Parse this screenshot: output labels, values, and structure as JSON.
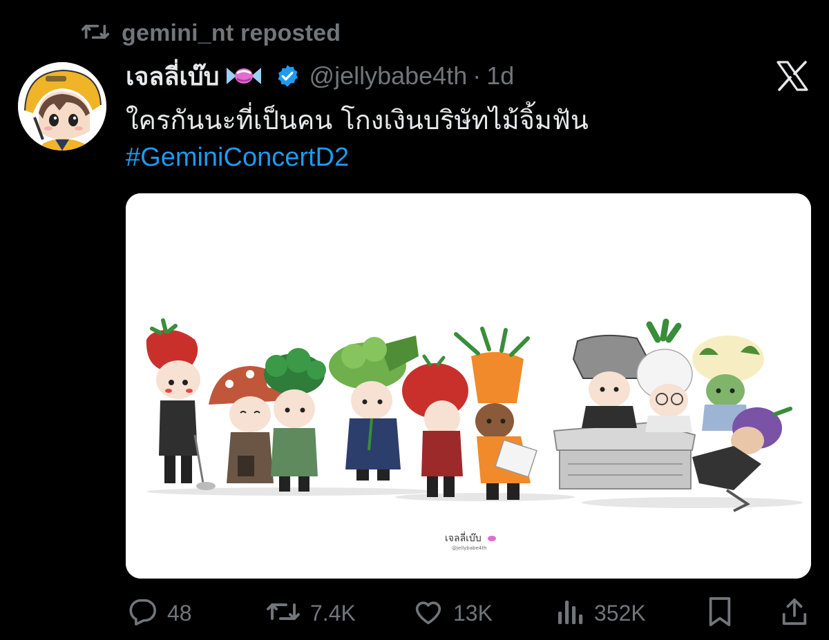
{
  "repost": {
    "text": "gemini_nt reposted",
    "icon": "repost-icon"
  },
  "author": {
    "display_name": "เจลลี่เบ๊บ",
    "emoji": "candy-icon",
    "verified": true,
    "handle": "@jellybabe4th",
    "separator": "·",
    "time": "1d"
  },
  "tweet": {
    "text": "ใครกันนะที่เป็นคน โกงเงินบริษัทไม้จิ้มฟัน",
    "hashtag": "#GeminiConcertD2"
  },
  "media": {
    "signature": "เจลลี่เบ๊บ",
    "signature_handle": "@jellybabe4th"
  },
  "actions": {
    "replies": "48",
    "reposts": "7.4K",
    "likes": "13K",
    "views": "352K"
  },
  "colors": {
    "background": "#000000",
    "text": "#e7e9ea",
    "muted": "#71767b",
    "link": "#1d9bf0",
    "verified": "#1d9bf0"
  }
}
